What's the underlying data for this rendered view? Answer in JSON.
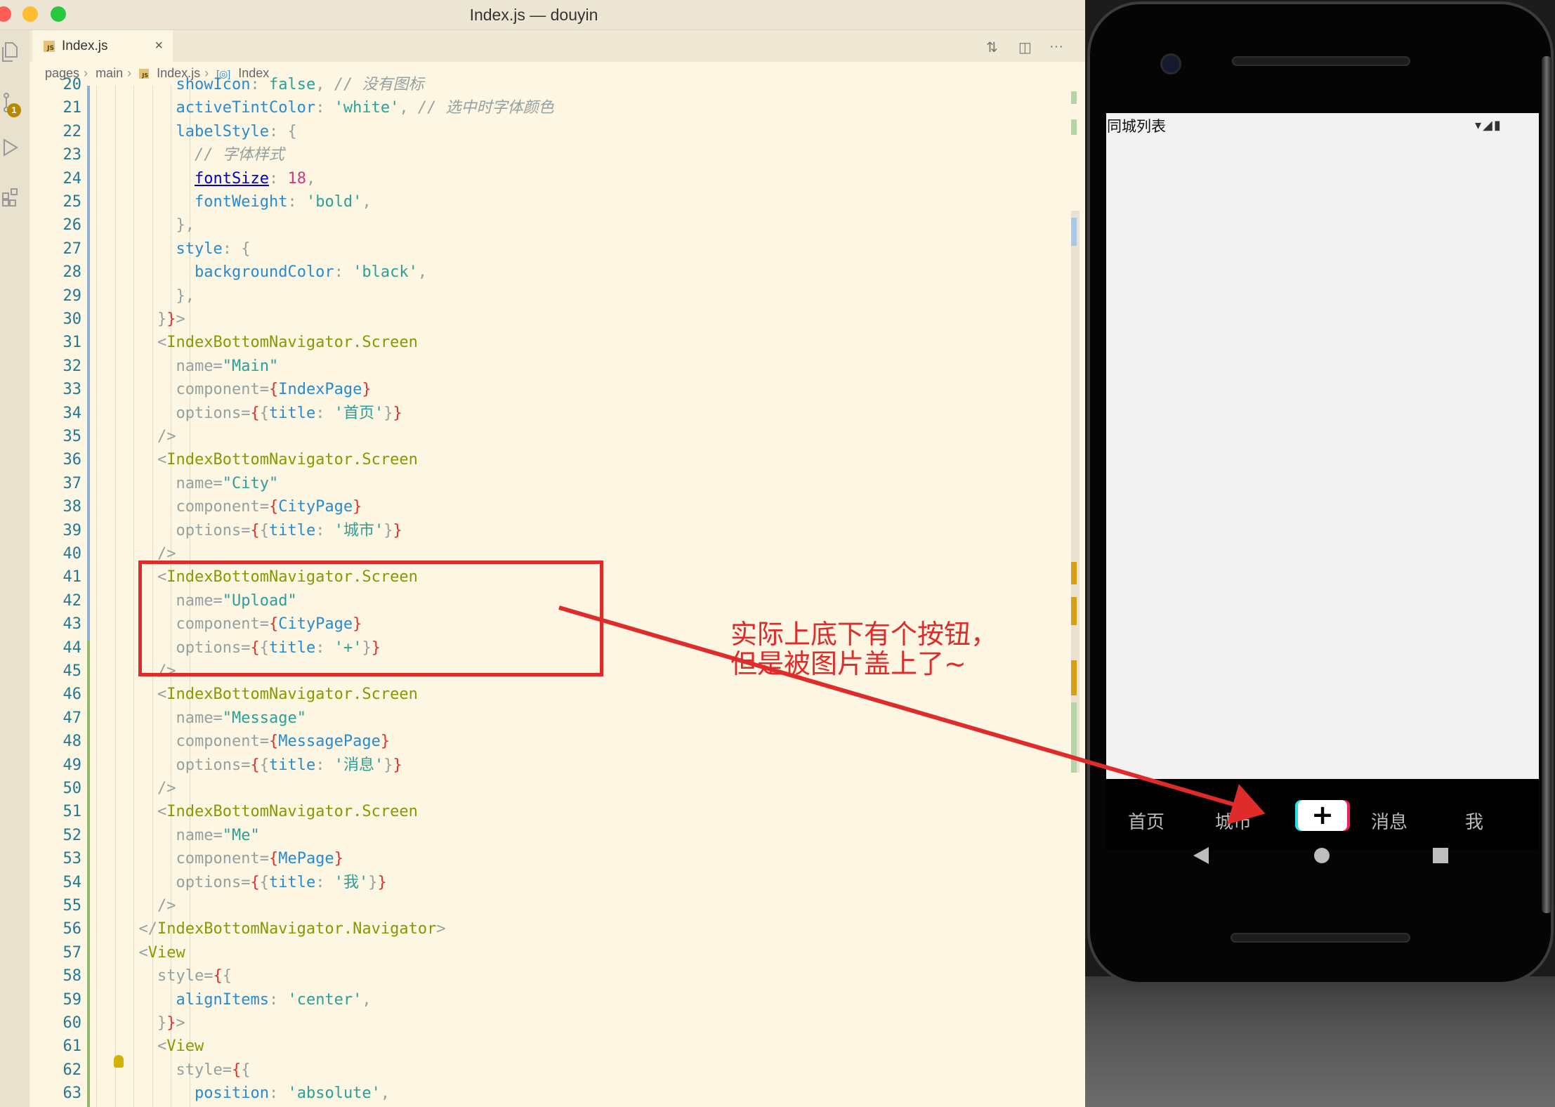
{
  "window": {
    "title": "Index.js — douyin"
  },
  "tabs": [
    {
      "label": "Index.js",
      "close": "×"
    }
  ],
  "breadcrumb": [
    "pages",
    "main",
    "Index.js",
    "Index"
  ],
  "activity_badge": "1",
  "code_lines": [
    {
      "num": "20",
      "tokens": [
        [
          "k",
          "showIcon"
        ],
        [
          "p",
          ": "
        ],
        [
          "s",
          "false"
        ],
        [
          "p",
          ", "
        ],
        [
          "c",
          "// 没有图标"
        ]
      ],
      "indent": 5
    },
    {
      "num": "21",
      "tokens": [
        [
          "k",
          "activeTintColor"
        ],
        [
          "p",
          ": "
        ],
        [
          "s",
          "'white'"
        ],
        [
          "p",
          ", "
        ],
        [
          "c",
          "// 选中时字体颜色"
        ]
      ],
      "indent": 5
    },
    {
      "num": "22",
      "tokens": [
        [
          "k",
          "labelStyle"
        ],
        [
          "p",
          ": {"
        ]
      ],
      "indent": 5
    },
    {
      "num": "23",
      "tokens": [
        [
          "c",
          "// 字体样式"
        ]
      ],
      "indent": 6
    },
    {
      "num": "24",
      "tokens": [
        [
          "u",
          "fontSize"
        ],
        [
          "p",
          ": "
        ],
        [
          "n",
          "18"
        ],
        [
          "p",
          ","
        ]
      ],
      "indent": 6
    },
    {
      "num": "25",
      "tokens": [
        [
          "k",
          "fontWeight"
        ],
        [
          "p",
          ": "
        ],
        [
          "s",
          "'bold'"
        ],
        [
          "p",
          ","
        ]
      ],
      "indent": 6
    },
    {
      "num": "26",
      "tokens": [
        [
          "p",
          "},"
        ]
      ],
      "indent": 5
    },
    {
      "num": "27",
      "tokens": [
        [
          "k",
          "style"
        ],
        [
          "p",
          ": {"
        ]
      ],
      "indent": 5
    },
    {
      "num": "28",
      "tokens": [
        [
          "k",
          "backgroundColor"
        ],
        [
          "p",
          ": "
        ],
        [
          "s",
          "'black'"
        ],
        [
          "p",
          ","
        ]
      ],
      "indent": 6
    },
    {
      "num": "29",
      "tokens": [
        [
          "p",
          "},"
        ]
      ],
      "indent": 5
    },
    {
      "num": "30",
      "tokens": [
        [
          "p",
          "}"
        ],
        [
          "b",
          "}"
        ],
        [
          "p",
          ">"
        ]
      ],
      "indent": 4
    },
    {
      "num": "31",
      "tokens": [
        [
          "p",
          "<"
        ],
        [
          "tg",
          "IndexBottomNavigator.Screen"
        ]
      ],
      "indent": 4
    },
    {
      "num": "32",
      "tokens": [
        [
          "p",
          "name="
        ],
        [
          "s",
          "\"Main\""
        ]
      ],
      "indent": 5
    },
    {
      "num": "33",
      "tokens": [
        [
          "p",
          "component="
        ],
        [
          "b",
          "{"
        ],
        [
          "k",
          "IndexPage"
        ],
        [
          "b",
          "}"
        ]
      ],
      "indent": 5
    },
    {
      "num": "34",
      "tokens": [
        [
          "p",
          "options="
        ],
        [
          "b",
          "{"
        ],
        [
          "p",
          "{"
        ],
        [
          "k",
          "title"
        ],
        [
          "p",
          ": "
        ],
        [
          "s",
          "'首页'"
        ],
        [
          "p",
          "}"
        ],
        [
          "b",
          "}"
        ]
      ],
      "indent": 5
    },
    {
      "num": "35",
      "tokens": [
        [
          "p",
          "/>"
        ]
      ],
      "indent": 4
    },
    {
      "num": "36",
      "tokens": [
        [
          "p",
          "<"
        ],
        [
          "tg",
          "IndexBottomNavigator.Screen"
        ]
      ],
      "indent": 4
    },
    {
      "num": "37",
      "tokens": [
        [
          "p",
          "name="
        ],
        [
          "s",
          "\"City\""
        ]
      ],
      "indent": 5
    },
    {
      "num": "38",
      "tokens": [
        [
          "p",
          "component="
        ],
        [
          "b",
          "{"
        ],
        [
          "k",
          "CityPage"
        ],
        [
          "b",
          "}"
        ]
      ],
      "indent": 5
    },
    {
      "num": "39",
      "tokens": [
        [
          "p",
          "options="
        ],
        [
          "b",
          "{"
        ],
        [
          "p",
          "{"
        ],
        [
          "k",
          "title"
        ],
        [
          "p",
          ": "
        ],
        [
          "s",
          "'城市'"
        ],
        [
          "p",
          "}"
        ],
        [
          "b",
          "}"
        ]
      ],
      "indent": 5
    },
    {
      "num": "40",
      "tokens": [
        [
          "p",
          "/>"
        ]
      ],
      "indent": 4
    },
    {
      "num": "41",
      "tokens": [
        [
          "p",
          "<"
        ],
        [
          "tg",
          "IndexBottomNavigator.Screen"
        ]
      ],
      "indent": 4
    },
    {
      "num": "42",
      "tokens": [
        [
          "p",
          "name="
        ],
        [
          "s",
          "\"Upload\""
        ]
      ],
      "indent": 5
    },
    {
      "num": "43",
      "tokens": [
        [
          "p",
          "component="
        ],
        [
          "b",
          "{"
        ],
        [
          "k",
          "CityPage"
        ],
        [
          "b",
          "}"
        ]
      ],
      "indent": 5
    },
    {
      "num": "44",
      "tokens": [
        [
          "p",
          "options="
        ],
        [
          "b",
          "{"
        ],
        [
          "p",
          "{"
        ],
        [
          "k",
          "title"
        ],
        [
          "p",
          ": "
        ],
        [
          "s",
          "'+'"
        ],
        [
          "p",
          "}"
        ],
        [
          "b",
          "}"
        ]
      ],
      "indent": 5
    },
    {
      "num": "45",
      "tokens": [
        [
          "p",
          "/>"
        ]
      ],
      "indent": 4
    },
    {
      "num": "46",
      "tokens": [
        [
          "p",
          "<"
        ],
        [
          "tg",
          "IndexBottomNavigator.Screen"
        ]
      ],
      "indent": 4
    },
    {
      "num": "47",
      "tokens": [
        [
          "p",
          "name="
        ],
        [
          "s",
          "\"Message\""
        ]
      ],
      "indent": 5
    },
    {
      "num": "48",
      "tokens": [
        [
          "p",
          "component="
        ],
        [
          "b",
          "{"
        ],
        [
          "k",
          "MessagePage"
        ],
        [
          "b",
          "}"
        ]
      ],
      "indent": 5
    },
    {
      "num": "49",
      "tokens": [
        [
          "p",
          "options="
        ],
        [
          "b",
          "{"
        ],
        [
          "p",
          "{"
        ],
        [
          "k",
          "title"
        ],
        [
          "p",
          ": "
        ],
        [
          "s",
          "'消息'"
        ],
        [
          "p",
          "}"
        ],
        [
          "b",
          "}"
        ]
      ],
      "indent": 5
    },
    {
      "num": "50",
      "tokens": [
        [
          "p",
          "/>"
        ]
      ],
      "indent": 4
    },
    {
      "num": "51",
      "tokens": [
        [
          "p",
          "<"
        ],
        [
          "tg",
          "IndexBottomNavigator.Screen"
        ]
      ],
      "indent": 4
    },
    {
      "num": "52",
      "tokens": [
        [
          "p",
          "name="
        ],
        [
          "s",
          "\"Me\""
        ]
      ],
      "indent": 5
    },
    {
      "num": "53",
      "tokens": [
        [
          "p",
          "component="
        ],
        [
          "b",
          "{"
        ],
        [
          "k",
          "MePage"
        ],
        [
          "b",
          "}"
        ]
      ],
      "indent": 5
    },
    {
      "num": "54",
      "tokens": [
        [
          "p",
          "options="
        ],
        [
          "b",
          "{"
        ],
        [
          "p",
          "{"
        ],
        [
          "k",
          "title"
        ],
        [
          "p",
          ": "
        ],
        [
          "s",
          "'我'"
        ],
        [
          "p",
          "}"
        ],
        [
          "b",
          "}"
        ]
      ],
      "indent": 5
    },
    {
      "num": "55",
      "tokens": [
        [
          "p",
          "/>"
        ]
      ],
      "indent": 4
    },
    {
      "num": "56",
      "tokens": [
        [
          "p",
          "</"
        ],
        [
          "tg",
          "IndexBottomNavigator.Navigator"
        ],
        [
          "p",
          ">"
        ]
      ],
      "indent": 3
    },
    {
      "num": "57",
      "tokens": [
        [
          "p",
          "<"
        ],
        [
          "tg",
          "View"
        ]
      ],
      "indent": 3
    },
    {
      "num": "58",
      "tokens": [
        [
          "p",
          "style="
        ],
        [
          "b",
          "{"
        ],
        [
          "p",
          "{"
        ]
      ],
      "indent": 4
    },
    {
      "num": "59",
      "tokens": [
        [
          "k",
          "alignItems"
        ],
        [
          "p",
          ": "
        ],
        [
          "s",
          "'center'"
        ],
        [
          "p",
          ","
        ]
      ],
      "indent": 5
    },
    {
      "num": "60",
      "tokens": [
        [
          "p",
          "}"
        ],
        [
          "b",
          "}"
        ],
        [
          "p",
          ">"
        ]
      ],
      "indent": 4
    },
    {
      "num": "61",
      "tokens": [
        [
          "p",
          "<"
        ],
        [
          "tg",
          "View"
        ]
      ],
      "indent": 4
    },
    {
      "num": "62",
      "tokens": [
        [
          "p",
          "style="
        ],
        [
          "b",
          "{"
        ],
        [
          "p",
          "{"
        ]
      ],
      "indent": 5
    },
    {
      "num": "63",
      "tokens": [
        [
          "k",
          "position"
        ],
        [
          "p",
          ": "
        ],
        [
          "s",
          "'absolute'"
        ],
        [
          "p",
          ","
        ]
      ],
      "indent": 6
    }
  ],
  "annotation": "实际上底下有个按钮，\n但是被图片盖上了~",
  "phone": {
    "header": "同城列表",
    "status_icons": "▾◢▮",
    "tabs": [
      "首页",
      "城市",
      "+",
      "消息",
      "我"
    ]
  }
}
